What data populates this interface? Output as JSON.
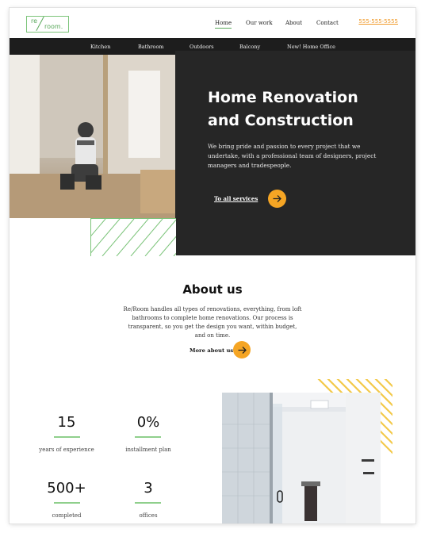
{
  "header": {
    "logo": {
      "top": "re",
      "bottom": "room."
    },
    "nav": [
      {
        "label": "Home",
        "active": true
      },
      {
        "label": "Our work",
        "active": false
      },
      {
        "label": "About",
        "active": false
      },
      {
        "label": "Contact",
        "active": false
      }
    ],
    "phone": "555-555-5555"
  },
  "categories": [
    "Kitchen",
    "Bathroom",
    "Outdoors",
    "Balcony",
    "New! Home Office"
  ],
  "hero": {
    "title_line1": "Home Renovation",
    "title_line2": "and Construction",
    "text": "We bring pride and passion to every project that we undertake, with a professional team of designers, project managers and tradespeople.",
    "link": "To all services"
  },
  "about": {
    "title": "About us",
    "text": "Re/Room handles all types of renovations, everything, from loft bathrooms to complete home renovations. Our process is transparent, so you get the design you want, within  budget, and on time.",
    "link": "More about us"
  },
  "stats": [
    {
      "value": "15",
      "label": "years of experience"
    },
    {
      "value": "0%",
      "label": "installment plan"
    },
    {
      "value": "500+",
      "label": "completed"
    },
    {
      "value": "3",
      "label": "offices"
    }
  ],
  "colors": {
    "accent": "#f5a524",
    "green": "#7cc47a",
    "dark": "#262626",
    "phone": "#f09a2a"
  },
  "icons": [
    "arrow-right-icon"
  ]
}
